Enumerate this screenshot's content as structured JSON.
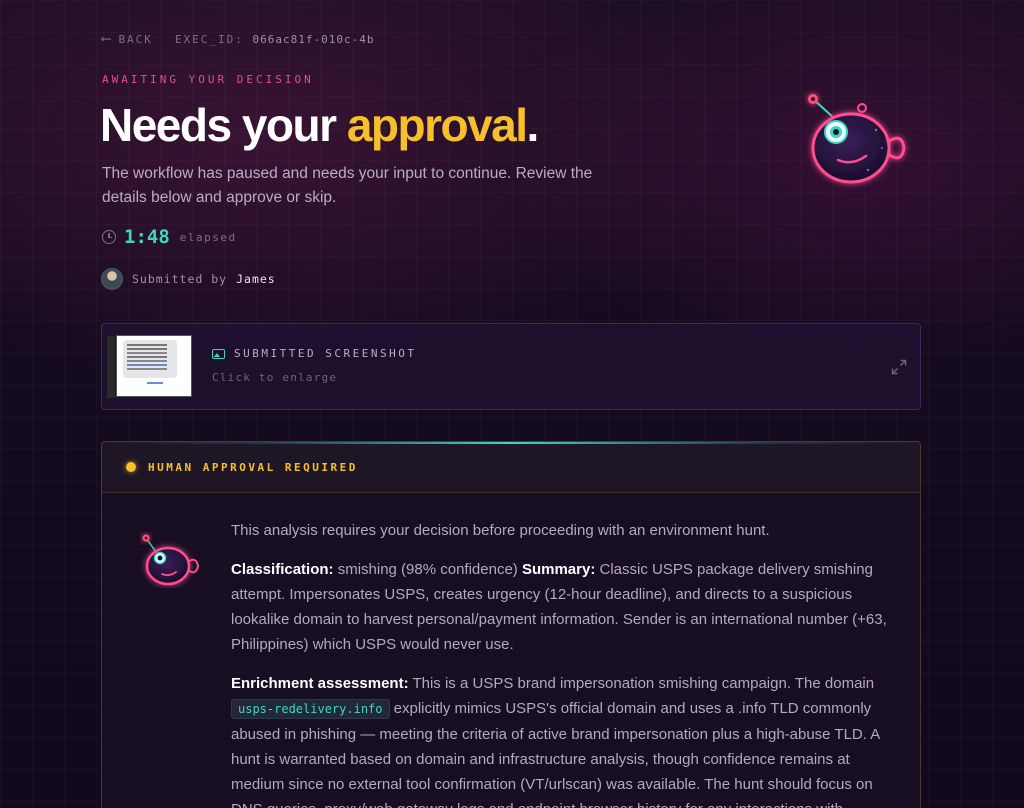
{
  "nav": {
    "back_label": "BACK",
    "back_arrow": "⟵",
    "exec_id_label": "EXEC_ID:",
    "exec_id_value": "066ac81f-010c-4b"
  },
  "header": {
    "eyebrow": "AWAITING YOUR DECISION",
    "title_prefix": "Needs your ",
    "title_accent": "approval",
    "title_suffix": ".",
    "description": "The workflow has paused and needs your input to continue. Review the details below and approve or skip."
  },
  "timer": {
    "value": "1:48",
    "label": "elapsed"
  },
  "submitter": {
    "prefix": "Submitted by",
    "name": "James"
  },
  "screenshot_card": {
    "label": "SUBMITTED SCREENSHOT",
    "hint": "Click to enlarge"
  },
  "approval": {
    "title": "HUMAN APPROVAL REQUIRED",
    "intro": "This analysis requires your decision before proceeding with an environment hunt.",
    "classification_label": "Classification:",
    "classification_value": " smishing (98% confidence) ",
    "summary_label": "Summary:",
    "summary_value": " Classic USPS package delivery smishing attempt. Impersonates USPS, creates urgency (12-hour deadline), and directs to a suspicious lookalike domain to harvest personal/payment information. Sender is an international number (+63, Philippines) which USPS would never use.",
    "enrichment_label": "Enrichment assessment:",
    "enrichment_part1": " This is a USPS brand impersonation smishing campaign. The domain ",
    "enrichment_domain": "usps-redelivery.info",
    "enrichment_part2": " explicitly mimics USPS's official domain and uses a .info TLD commonly abused in phishing — meeting the criteria of active brand impersonation plus a high-abuse TLD. A hunt is warranted based on domain and infrastructure analysis, though confidence remains at medium since no external tool confirmation (VT/urlscan) was available. The hunt should focus on DNS queries, proxy/web gateway logs and endpoint browser history for any interactions with"
  },
  "colors": {
    "accent_yellow": "#f5c02a",
    "accent_teal": "#3ed6c0",
    "accent_pink": "#e0508a"
  },
  "icons": [
    "back-arrow-icon",
    "clock-icon",
    "avatar",
    "image-icon",
    "expand-icon",
    "status-dot",
    "mascot"
  ]
}
